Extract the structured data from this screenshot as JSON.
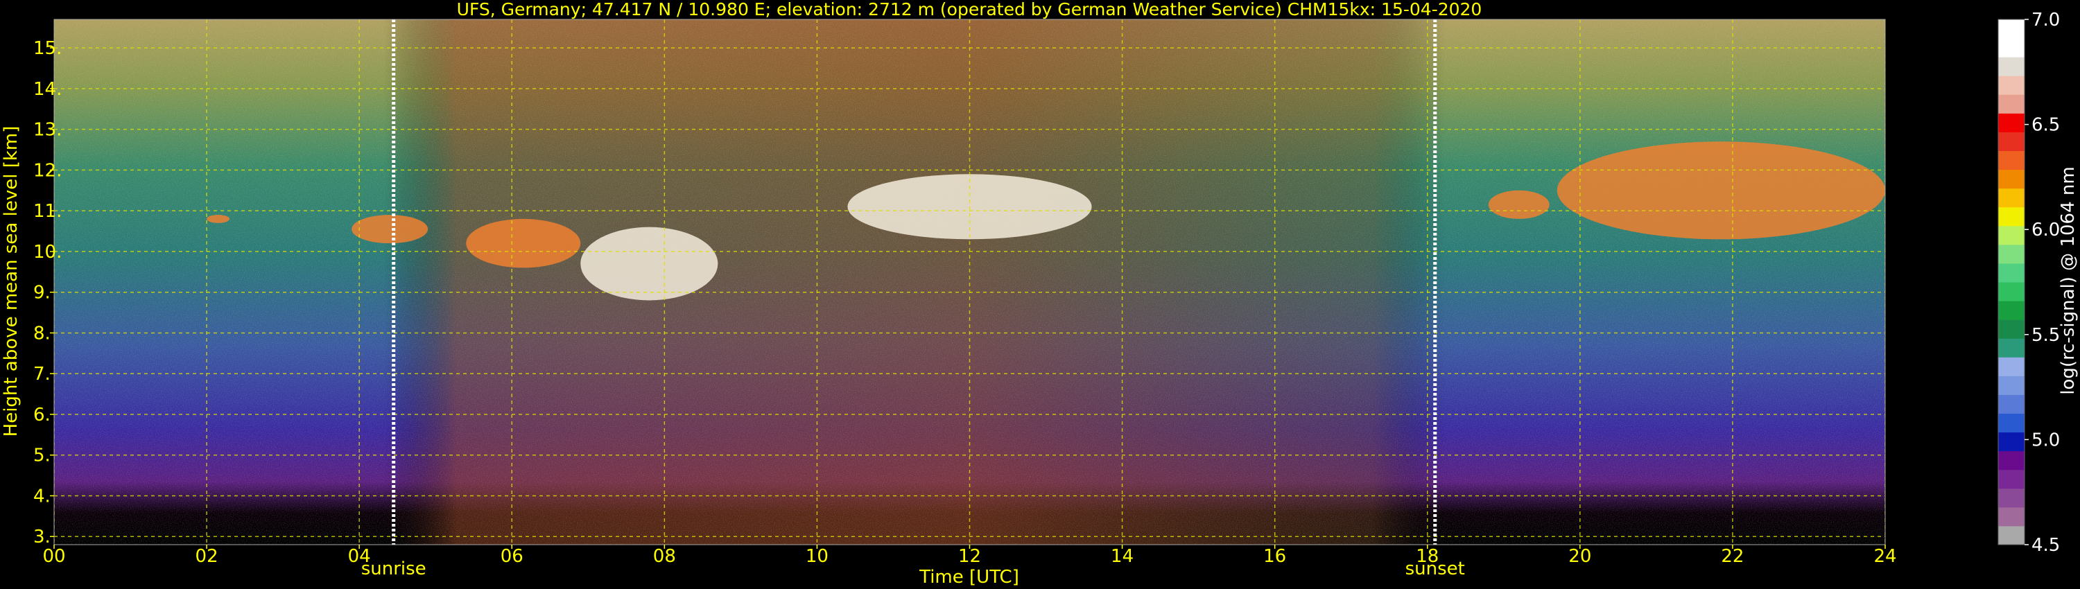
{
  "chart_data": {
    "type": "heatmap",
    "title": "UFS, Germany; 47.417 N / 10.980 E; elevation: 2712 m  (operated by German Weather Service)    CHM15kx: 15-04-2020",
    "xlabel": "Time [UTC]",
    "ylabel": "Height above mean sea level [km]",
    "xlim": [
      0,
      24
    ],
    "ylim": [
      2.8,
      15.7
    ],
    "x_ticks": [
      "00",
      "02",
      "04",
      "06",
      "08",
      "10",
      "12",
      "14",
      "16",
      "18",
      "20",
      "22",
      "24"
    ],
    "y_ticks": [
      "3.",
      "4.",
      "5.",
      "6.",
      "7.",
      "8.",
      "9.",
      "10.",
      "11.",
      "12.",
      "13.",
      "14.",
      "15."
    ],
    "grid": true,
    "markers": [
      {
        "label": "sunrise",
        "time": 4.45
      },
      {
        "label": "sunset",
        "time": 18.1
      }
    ],
    "colorbar": {
      "label": "log(rc-signal) @ 1064 nm",
      "range": [
        4.5,
        7.0
      ],
      "ticks": [
        "4.5",
        "5.0",
        "5.5",
        "6.0",
        "6.5",
        "7.0"
      ],
      "colors": [
        "#a9a9a9",
        "#a06a9a",
        "#8a4a98",
        "#7a2896",
        "#6a0a8c",
        "#0a1ab0",
        "#2a5ad0",
        "#5a7ad8",
        "#7a98e0",
        "#98aee8",
        "#2a9a7a",
        "#1a8a4a",
        "#18a040",
        "#30c060",
        "#50d080",
        "#80e080",
        "#b8f060",
        "#f0f000",
        "#f8c000",
        "#f08800",
        "#f06020",
        "#e83020",
        "#f00000",
        "#e8a090",
        "#f0c0b0",
        "#e0dcd4",
        "#ffffff",
        "#ffffff"
      ]
    },
    "cloud_layers": [
      {
        "start": 2.0,
        "end": 2.3,
        "base": 10.7,
        "top": 10.9
      },
      {
        "start": 3.9,
        "end": 4.9,
        "base": 10.2,
        "top": 10.9
      },
      {
        "start": 5.4,
        "end": 6.9,
        "base": 9.6,
        "top": 10.8
      },
      {
        "start": 6.9,
        "end": 8.7,
        "base": 8.8,
        "top": 10.6
      },
      {
        "start": 10.4,
        "end": 13.6,
        "base": 10.3,
        "top": 11.9
      },
      {
        "start": 18.8,
        "end": 19.6,
        "base": 10.8,
        "top": 11.5
      },
      {
        "start": 19.7,
        "end": 24.0,
        "base": 10.3,
        "top": 12.7
      }
    ]
  }
}
